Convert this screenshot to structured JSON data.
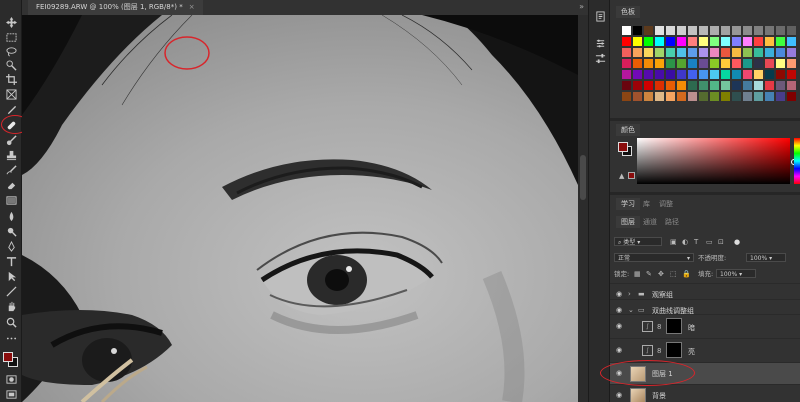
{
  "document": {
    "tab_title": "FEI09289.ARW @ 100% (图层 1, RGB/8*) *",
    "close": "×"
  },
  "panels": {
    "swatches": {
      "tab": "色板"
    },
    "color": {
      "tab": "颜色"
    },
    "learn_tabs": [
      "学习",
      "库",
      "调整"
    ],
    "layer_tabs": [
      "图层",
      "通道",
      "路径"
    ],
    "layers_controls": {
      "filter_kind": "类型",
      "blend_mode": "正常",
      "opacity_label": "不透明度:",
      "opacity_value": "100%",
      "lock_label": "锁定:",
      "fill_label": "填充:",
      "fill_value": "100%"
    },
    "layers": [
      {
        "name": "观察组",
        "kind": "group"
      },
      {
        "name": "双曲线调整组",
        "kind": "group"
      },
      {
        "name": "暗",
        "kind": "curves"
      },
      {
        "name": "亮",
        "kind": "curves"
      },
      {
        "name": "图层 1",
        "kind": "pixel",
        "selected": true
      },
      {
        "name": "背景",
        "kind": "pixel"
      }
    ]
  },
  "colors": {
    "foreground": "#8a0c0c",
    "background": "#111111",
    "highlight": "#d8252b",
    "swatch_rows": [
      [
        "#ffffff",
        "#000000",
        "#5c3a1d",
        "#e1e1e1",
        "#d9d9d9",
        "#cfcfcf",
        "#c3c3c3",
        "#b8b8b8",
        "#adadad",
        "#a2a2a2",
        "#979797",
        "#8c8c8c",
        "#818181",
        "#767676",
        "#6b6b6b",
        "#606060"
      ],
      [
        "#ff0000",
        "#ffff00",
        "#00ff00",
        "#00ffff",
        "#0000ff",
        "#ff00ff",
        "#ff7f7f",
        "#ffff7f",
        "#7fff7f",
        "#7fffff",
        "#7f7fff",
        "#ff7fff",
        "#ff3f3f",
        "#ffbf3f",
        "#3fff3f",
        "#3fbfff"
      ],
      [
        "#f25f5c",
        "#f7a35c",
        "#f9d65c",
        "#a0d468",
        "#48cfad",
        "#4fc1e9",
        "#5d9cec",
        "#ac92ec",
        "#ec87c0",
        "#e9573f",
        "#f6bb42",
        "#8cc152",
        "#37bc9b",
        "#3bafda",
        "#4a89dc",
        "#967adc"
      ],
      [
        "#d81e5b",
        "#e85d04",
        "#f48c06",
        "#faa307",
        "#2b9348",
        "#55a630",
        "#1982c4",
        "#6a4c93",
        "#8ac926",
        "#ffca3a",
        "#ff595e",
        "#1b998b",
        "#2d3047",
        "#e84855",
        "#fffd82",
        "#ff9b71"
      ],
      [
        "#b5179e",
        "#7209b7",
        "#560bad",
        "#480ca8",
        "#3a0ca3",
        "#3f37c9",
        "#4361ee",
        "#4895ef",
        "#4cc9f0",
        "#06d6a0",
        "#118ab2",
        "#ef476f",
        "#ffd166",
        "#073b4c",
        "#8d0801",
        "#bf0603"
      ],
      [
        "#6a040f",
        "#9d0208",
        "#d00000",
        "#dc2f02",
        "#e85d04",
        "#f48c06",
        "#2d6a4f",
        "#40916c",
        "#52b788",
        "#74c69d",
        "#1d3557",
        "#457b9d",
        "#a8dadc",
        "#e63946",
        "#6d597a",
        "#b56576"
      ],
      [
        "#8b4513",
        "#a0522d",
        "#cd853f",
        "#deb887",
        "#f4a460",
        "#d2691e",
        "#bc8f8f",
        "#556b2f",
        "#6b8e23",
        "#808000",
        "#2f4f4f",
        "#708090",
        "#5f9ea0",
        "#4682b4",
        "#483d8b",
        "#800000"
      ]
    ]
  },
  "icons": {
    "tools": [
      "move-icon",
      "marquee-icon",
      "lasso-icon",
      "quick-select-icon",
      "crop-icon",
      "frame-icon",
      "eyedropper-icon",
      "healing-brush-icon",
      "brush-icon",
      "clone-stamp-icon",
      "history-brush-icon",
      "eraser-icon",
      "gradient-icon",
      "blur-icon",
      "dodge-icon",
      "pen-icon",
      "type-icon",
      "path-select-icon",
      "line-icon",
      "hand-icon",
      "zoom-icon",
      "more-icon",
      "quick-mask-icon",
      "screen-mode-icon"
    ],
    "strip": [
      "history-icon",
      "properties-icon",
      "adjust-icon"
    ]
  }
}
